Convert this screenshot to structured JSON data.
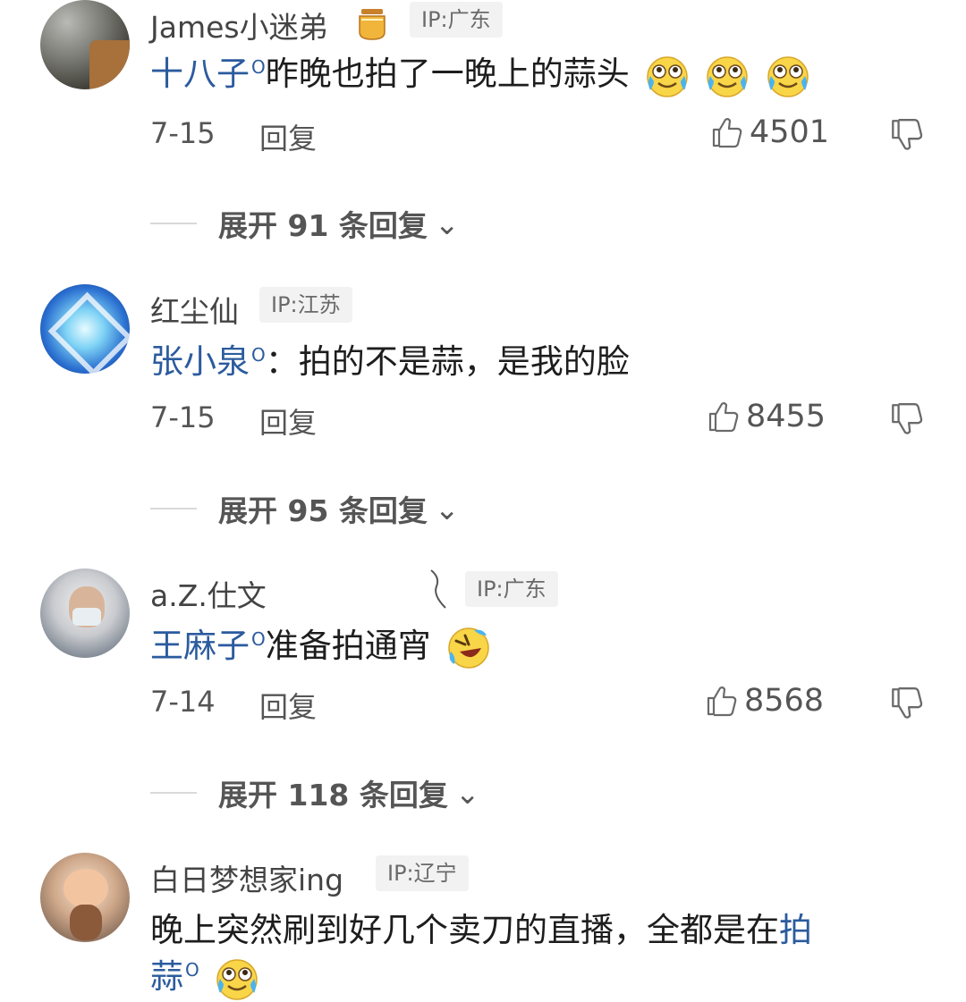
{
  "comments": [
    {
      "username": "James小迷弟",
      "ip": "IP:广东",
      "mention": "十八子",
      "text": "昨晚也拍了一晚上的蒜头",
      "emojis": [
        "cry-laugh-emoji",
        "cry-laugh-emoji",
        "cry-laugh-emoji"
      ],
      "date": "7-15",
      "reply_label": "回复",
      "likes": "4501",
      "expand_label": "展开 91 条回复"
    },
    {
      "username": "红尘仙",
      "ip": "IP:江苏",
      "mention": "张小泉",
      "text": "：拍的不是蒜，是我的脸",
      "date": "7-15",
      "reply_label": "回复",
      "likes": "8455",
      "expand_label": "展开 95 条回复"
    },
    {
      "username": "a.Z.仕文",
      "ip": "IP:广东",
      "mention": "王麻子",
      "text": "准备拍通宵",
      "emojis": [
        "rolling-laugh-emoji"
      ],
      "date": "7-14",
      "reply_label": "回复",
      "likes": "8568",
      "expand_label": "展开 118 条回复"
    },
    {
      "username": "白日梦想家ing",
      "ip": "IP:辽宁",
      "text_line1": "晚上突然刷到好几个卖刀的直播，全都是在",
      "mention_part1": "拍",
      "mention_part2": "蒜",
      "emojis": [
        "cry-laugh-emoji"
      ]
    }
  ],
  "colors": {
    "mention": "#2b5b9e",
    "meta_text": "#555555",
    "ip_bg": "#f2f2f2"
  },
  "icons": [
    "thumbs-up-icon",
    "thumbs-down-icon",
    "search-mention-icon",
    "honey-pot-badge-icon"
  ]
}
